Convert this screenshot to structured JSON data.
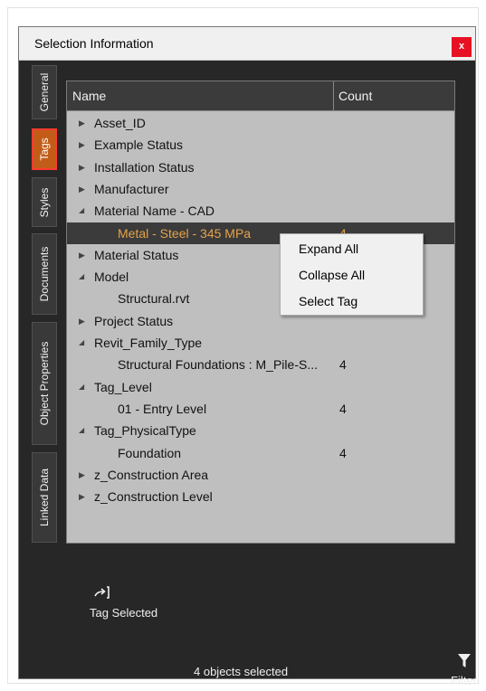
{
  "window": {
    "title": "Selection Information",
    "close_glyph": "x"
  },
  "side_tabs": [
    {
      "label": "General",
      "active": false
    },
    {
      "label": "Tags",
      "active": true
    },
    {
      "label": "Styles",
      "active": false
    },
    {
      "label": "Documents",
      "active": false
    },
    {
      "label": "Object Properties",
      "active": false
    },
    {
      "label": "Linked Data",
      "active": false
    }
  ],
  "tree": {
    "columns": {
      "name": "Name",
      "count": "Count"
    },
    "rows": [
      {
        "label": "Asset_ID",
        "count": "",
        "expander": "collapsed",
        "level": 0
      },
      {
        "label": "Example Status",
        "count": "",
        "expander": "collapsed",
        "level": 0
      },
      {
        "label": "Installation Status",
        "count": "",
        "expander": "collapsed",
        "level": 0
      },
      {
        "label": "Manufacturer",
        "count": "",
        "expander": "collapsed",
        "level": 0
      },
      {
        "label": "Material Name - CAD",
        "count": "",
        "expander": "expanded",
        "level": 0
      },
      {
        "label": "Metal - Steel - 345 MPa",
        "count": "4",
        "expander": "none",
        "level": 1,
        "selected": true
      },
      {
        "label": "Material Status",
        "count": "",
        "expander": "collapsed",
        "level": 0
      },
      {
        "label": "Model",
        "count": "",
        "expander": "expanded",
        "level": 0
      },
      {
        "label": "Structural.rvt",
        "count": "",
        "expander": "none",
        "level": 1
      },
      {
        "label": "Project Status",
        "count": "",
        "expander": "collapsed",
        "level": 0
      },
      {
        "label": "Revit_Family_Type",
        "count": "",
        "expander": "expanded",
        "level": 0
      },
      {
        "label": "Structural Foundations : M_Pile-S...",
        "count": "4",
        "expander": "none",
        "level": 1
      },
      {
        "label": "Tag_Level",
        "count": "",
        "expander": "expanded",
        "level": 0
      },
      {
        "label": "01 - Entry Level",
        "count": "4",
        "expander": "none",
        "level": 1
      },
      {
        "label": "Tag_PhysicalType",
        "count": "",
        "expander": "expanded",
        "level": 0
      },
      {
        "label": "Foundation",
        "count": "4",
        "expander": "none",
        "level": 1
      },
      {
        "label": "z_Construction Area",
        "count": "",
        "expander": "collapsed",
        "level": 0
      },
      {
        "label": "z_Construction Level",
        "count": "",
        "expander": "collapsed",
        "level": 0
      }
    ]
  },
  "context_menu": {
    "items": [
      "Expand All",
      "Collapse All",
      "Select Tag"
    ]
  },
  "toolbar": {
    "tag_selected_label": "Tag Selected",
    "tag_selected_icon": "tag-arrow-icon"
  },
  "status": {
    "text": "4 objects selected"
  },
  "filter": {
    "label": "Filter",
    "icon": "funnel-icon"
  },
  "colors": {
    "accent_tab": "#c35c18",
    "tab_highlight_border": "#ff3b2f",
    "selected_text": "#e6a24a",
    "close_button": "#e81123"
  }
}
